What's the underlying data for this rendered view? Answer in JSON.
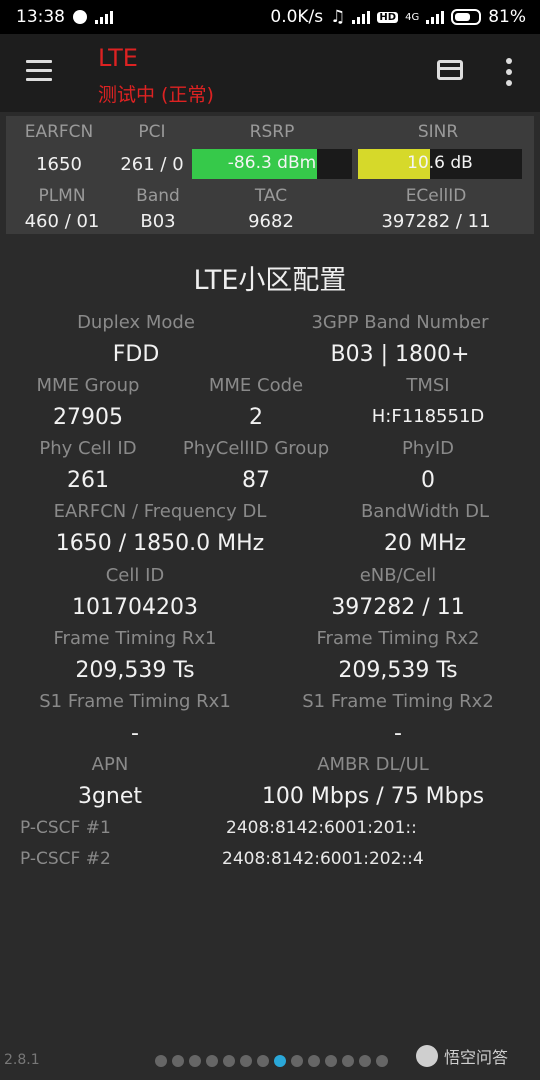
{
  "status_bar": {
    "time": "13:38",
    "speed": "0.0K/s",
    "battery": "81%",
    "network": "4G"
  },
  "app": {
    "title": "LTE",
    "subtitle": "测试中 (正常)"
  },
  "summary": {
    "h1": [
      "EARFCN",
      "PCI",
      "RSRP",
      "SINR"
    ],
    "v1": {
      "earfcn": "1650",
      "pci": "261 / 0",
      "rsrp": "-86.3 dBm",
      "sinr": "10.6 dB"
    },
    "h2": [
      "PLMN",
      "Band",
      "TAC",
      "ECellID"
    ],
    "v2": {
      "plmn": "460 / 01",
      "band": "B03",
      "tac": "9682",
      "ecellid": "397282 / 11"
    },
    "rsrp_fill": 0.78,
    "sinr_fill": 0.44,
    "rsrp_color": "#36c94a",
    "sinr_color": "#d6d92a"
  },
  "section_title": "LTE小区配置",
  "fields": [
    {
      "label": "Duplex Mode",
      "value": "FDD"
    },
    {
      "label": "3GPP Band Number",
      "value": "B03 | 1800+"
    },
    {
      "label": "MME Group",
      "value": "27905"
    },
    {
      "label": "MME Code",
      "value": "2"
    },
    {
      "label": "TMSI",
      "value": "H:F118551D"
    },
    {
      "label": "Phy Cell ID",
      "value": "261"
    },
    {
      "label": "PhyCellID Group",
      "value": "87"
    },
    {
      "label": "PhyID",
      "value": "0"
    },
    {
      "label": "EARFCN / Frequency DL",
      "value": "1650 / 1850.0 MHz"
    },
    {
      "label": "BandWidth DL",
      "value": "20 MHz"
    },
    {
      "label": "Cell ID",
      "value": "101704203"
    },
    {
      "label": "eNB/Cell",
      "value": "397282 / 11"
    },
    {
      "label": "Frame Timing Rx1",
      "value": "209,539 Ts"
    },
    {
      "label": "Frame Timing Rx2",
      "value": "209,539 Ts"
    },
    {
      "label": "S1 Frame Timing Rx1",
      "value": "-"
    },
    {
      "label": "S1 Frame Timing Rx2",
      "value": "-"
    },
    {
      "label": "APN",
      "value": "3gnet"
    },
    {
      "label": "AMBR DL/UL",
      "value": "100 Mbps / 75 Mbps"
    }
  ],
  "pcscf": [
    {
      "label": "P-CSCF #1",
      "value": "2408:8142:6001:201::"
    },
    {
      "label": "P-CSCF #2",
      "value": "2408:8142:6001:202::4"
    }
  ],
  "footer": {
    "version": "2.8.1",
    "page_count": 14,
    "active_page": 8,
    "watermark": "悟空问答"
  }
}
